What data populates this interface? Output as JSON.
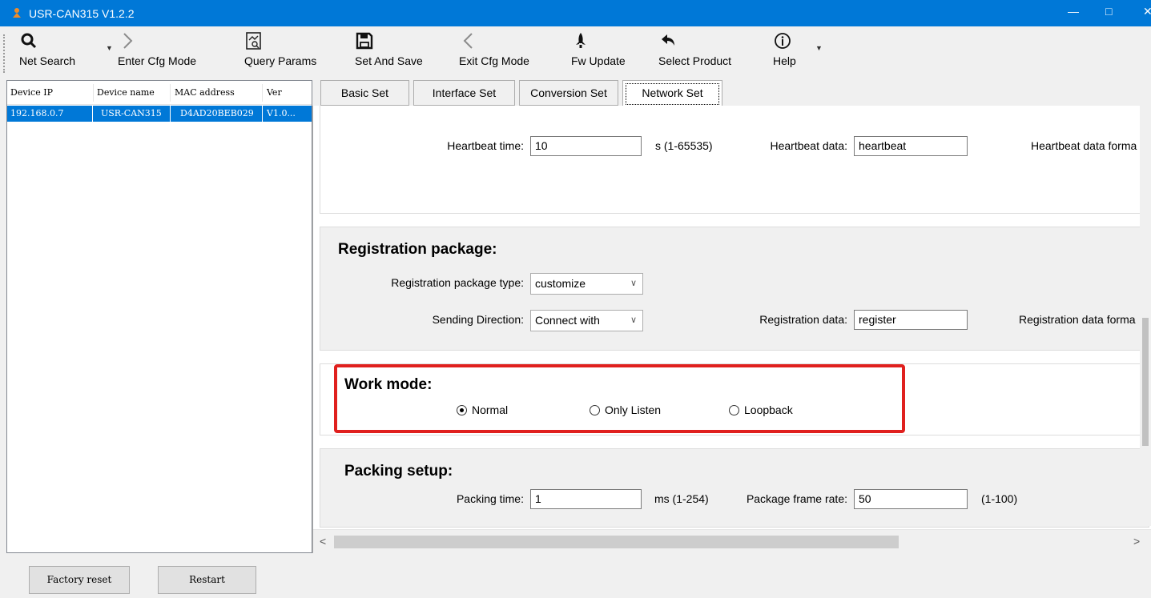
{
  "window": {
    "title": "USR-CAN315 V1.2.2",
    "min_glyph": "—",
    "max_glyph": "□",
    "close_glyph": "✕"
  },
  "toolbar": {
    "items": [
      {
        "label": "Net Search",
        "icon": "search-icon",
        "enabled": true
      },
      {
        "label": "Enter Cfg Mode",
        "icon": "chevron-right-icon",
        "enabled": false
      },
      {
        "label": "Query Params",
        "icon": "query-doc-icon",
        "enabled": true
      },
      {
        "label": "Set And Save",
        "icon": "save-icon",
        "enabled": true
      },
      {
        "label": "Exit Cfg Mode",
        "icon": "chevron-left-icon",
        "enabled": false
      },
      {
        "label": "Fw Update",
        "icon": "rocket-icon",
        "enabled": true
      },
      {
        "label": "Select Product",
        "icon": "back-arrow-icon",
        "enabled": true
      },
      {
        "label": "Help",
        "icon": "info-icon",
        "enabled": true
      }
    ]
  },
  "device_list": {
    "columns": [
      "Device IP",
      "Device name",
      "MAC address",
      "Ver"
    ],
    "rows": [
      [
        "192.168.0.7",
        "USR-CAN315",
        "D4AD20BEB029",
        "V1.0..."
      ]
    ]
  },
  "tabs": [
    "Basic Set",
    "Interface Set",
    "Conversion Set",
    "Network Set"
  ],
  "active_tab": "Network Set",
  "heartbeat": {
    "time_label": "Heartbeat time:",
    "time_value": "10",
    "time_range": "s (1-65535)",
    "data_label": "Heartbeat data:",
    "data_value": "heartbeat",
    "format_label": "Heartbeat data forma"
  },
  "registration": {
    "heading": "Registration package:",
    "type_label": "Registration package type:",
    "type_value": "customize",
    "direction_label": "Sending Direction:",
    "direction_value": "Connect with",
    "data_label": "Registration data:",
    "data_value": "register",
    "format_label": "Registration data forma"
  },
  "work_mode": {
    "heading": "Work mode:",
    "options": [
      "Normal",
      "Only Listen",
      "Loopback"
    ],
    "selected": "Normal"
  },
  "packing": {
    "heading": "Packing setup:",
    "time_label": "Packing time:",
    "time_value": "1",
    "time_range": "ms (1-254)",
    "rate_label": "Package frame rate:",
    "rate_value": "50",
    "rate_range": "(1-100)"
  },
  "buttons": {
    "factory_reset": "Factory reset",
    "restart": "Restart"
  },
  "colors": {
    "title_bar": "#0078d7",
    "selection": "#0078d7",
    "highlight": "#e0201e"
  }
}
